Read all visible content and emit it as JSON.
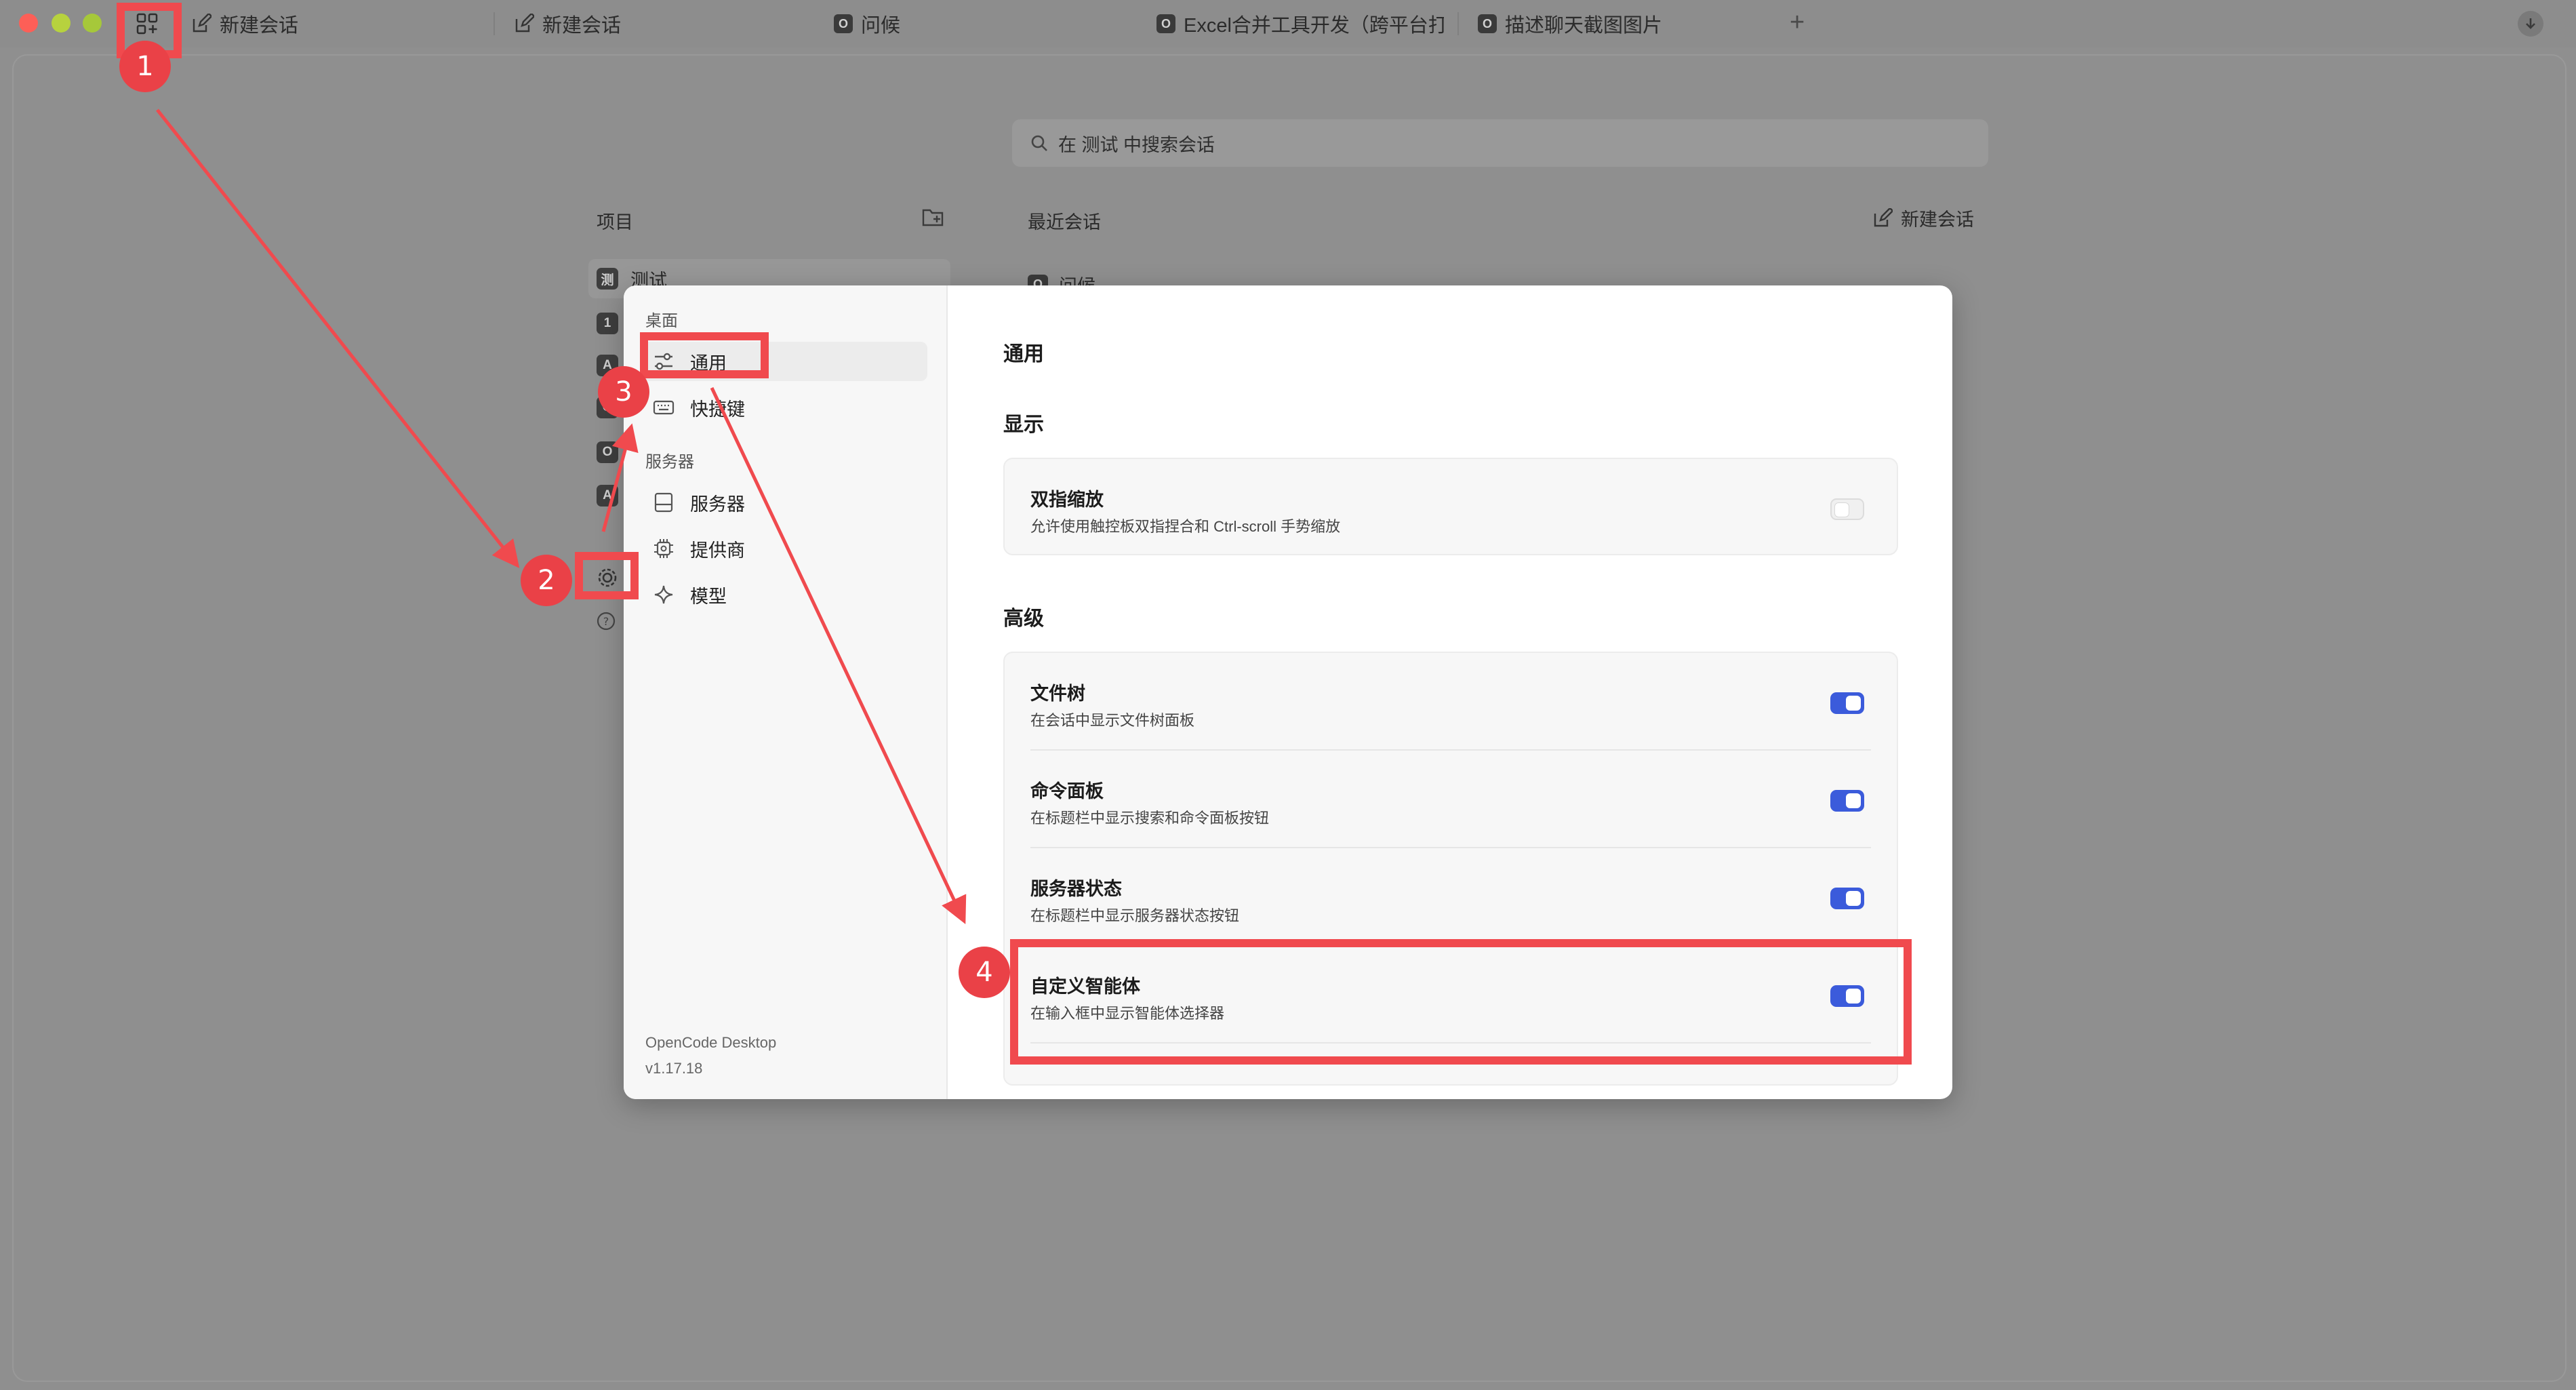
{
  "titlebar": {
    "traffic_colors": [
      "#ff5f57",
      "#28c840",
      "#febc2e"
    ],
    "tabs": [
      {
        "icon": "edit-icon",
        "label": "新建会话"
      },
      {
        "icon": "edit-icon",
        "label": "新建会话"
      },
      {
        "icon": "o-logo-icon",
        "label": "问候"
      },
      {
        "icon": "o-logo-icon",
        "label": "Excel合并工具开发（跨平台打包"
      },
      {
        "icon": "o-logo-icon",
        "label": "描述聊天截图图片"
      }
    ],
    "add_tab": "+"
  },
  "main": {
    "search_placeholder": "在 测试 中搜索会话",
    "projects_header": "项目",
    "recent_header": "最近会话",
    "new_session": "新建会话",
    "projects": [
      {
        "avatar": "测",
        "name": "测试"
      },
      {
        "avatar": "1",
        "name": ""
      },
      {
        "avatar": "A",
        "name": ""
      },
      {
        "avatar": "O",
        "name": ""
      },
      {
        "avatar": "O",
        "name": ""
      },
      {
        "avatar": "A",
        "name": ""
      }
    ],
    "recent_first": "问候"
  },
  "settings": {
    "sidebar": {
      "group_desktop": "桌面",
      "nav_general": "通用",
      "nav_shortcuts": "快捷键",
      "group_server": "服务器",
      "nav_servers": "服务器",
      "nav_providers": "提供商",
      "nav_models": "模型",
      "app_name": "OpenCode Desktop",
      "app_version": "v1.17.18"
    },
    "page_title": "通用",
    "display_section": "显示",
    "advanced_section": "高级",
    "pinch_zoom": {
      "title": "双指缩放",
      "desc": "允许使用触控板双指捏合和 Ctrl-scroll 手势缩放",
      "enabled": false
    },
    "file_tree": {
      "title": "文件树",
      "desc": "在会话中显示文件树面板",
      "enabled": true
    },
    "command_palette": {
      "title": "命令面板",
      "desc": "在标题栏中显示搜索和命令面板按钮",
      "enabled": true
    },
    "server_status": {
      "title": "服务器状态",
      "desc": "在标题栏中显示服务器状态按钮",
      "enabled": true
    },
    "custom_agents": {
      "title": "自定义智能体",
      "desc": "在输入框中显示智能体选择器",
      "enabled": true
    }
  },
  "annotations": {
    "color": "#f04a4e",
    "steps": [
      "1",
      "2",
      "3",
      "4"
    ]
  }
}
